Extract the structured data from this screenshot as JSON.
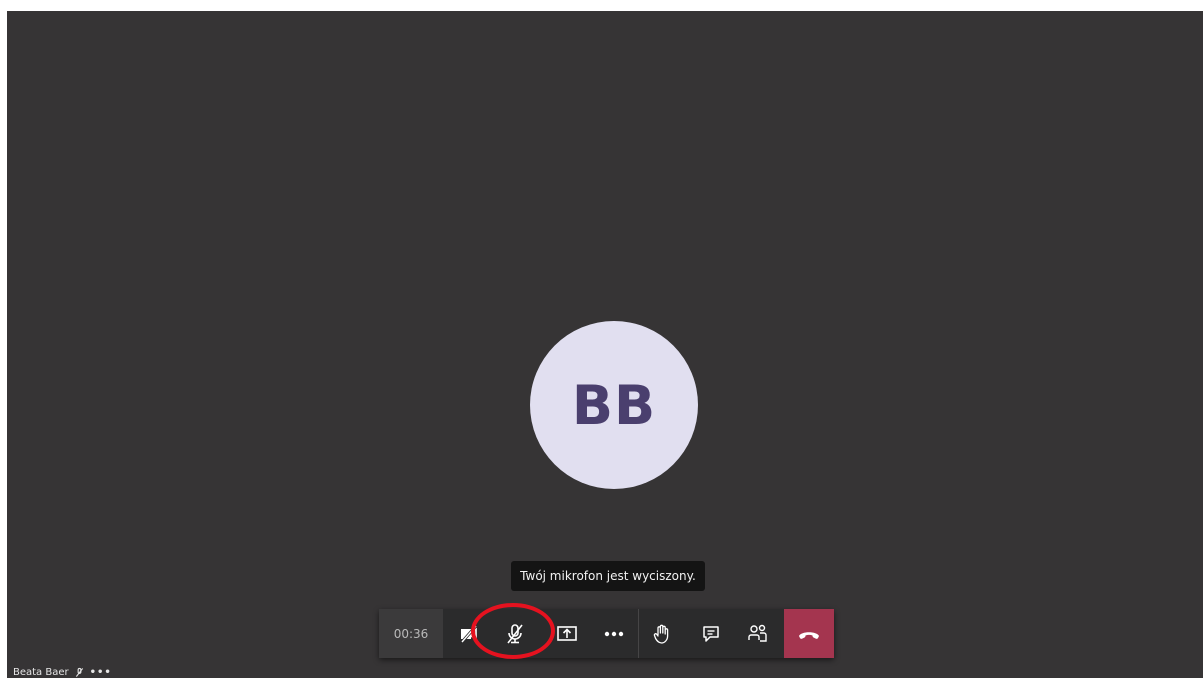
{
  "participant": {
    "initials": "BB",
    "name": "Beata Baer",
    "more_glyph": "•••"
  },
  "tooltip": {
    "text": "Twój mikrofon jest wyciszony."
  },
  "toolbar": {
    "timer": "00:36",
    "buttons": [
      {
        "name": "camera-off",
        "icon": "video-off-icon"
      },
      {
        "name": "microphone-muted",
        "icon": "mic-off-icon",
        "state": "muted"
      },
      {
        "name": "share-screen",
        "icon": "share-screen-icon"
      },
      {
        "name": "more-actions",
        "icon": "more-horizontal-icon"
      },
      {
        "name": "raise-hand",
        "icon": "hand-icon"
      },
      {
        "name": "chat",
        "icon": "chat-icon"
      },
      {
        "name": "participants",
        "icon": "people-icon"
      },
      {
        "name": "hang-up",
        "icon": "phone-hangup-icon"
      }
    ]
  },
  "colors": {
    "stage_bg": "#363435",
    "avatar_bg": "#e1dff0",
    "avatar_text": "#4a3f6e",
    "toolbar_bg": "#2b2b2c",
    "hangup_bg": "#a4354f",
    "highlight_ring": "#e5121f"
  }
}
